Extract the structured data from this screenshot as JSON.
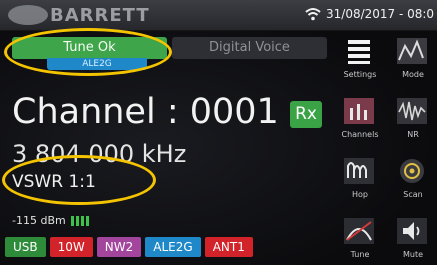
{
  "header": {
    "brand": "BARRETT",
    "datetime": "31/08/2017 - 08:0"
  },
  "tabs": {
    "tune_status": "Tune Ok",
    "ale_label": "ALE2G",
    "digital_voice": "Digital Voice"
  },
  "main": {
    "channel": "Channel : 0001",
    "rx_badge": "Rx",
    "frequency": "3 804 000 kHz",
    "vswr": "VSWR 1:1",
    "signal_level": "-115 dBm"
  },
  "status_chips": [
    {
      "label": "USB",
      "color": "#2e8b3a"
    },
    {
      "label": "10W",
      "color": "#d2232a"
    },
    {
      "label": "NW2",
      "color": "#a3449d"
    },
    {
      "label": "ALE2G",
      "color": "#1f88c9"
    },
    {
      "label": "ANT1",
      "color": "#d2232a"
    }
  ],
  "side_panel": {
    "settings": "Settings",
    "mode": "Mode",
    "channels": "Channels",
    "nr": "NR",
    "hop": "Hop",
    "scan": "Scan",
    "tune": "Tune",
    "mute": "Mute"
  },
  "colors": {
    "accent_green": "#3fa54a",
    "accent_blue": "#1f88c9",
    "highlight": "#f5c400"
  }
}
